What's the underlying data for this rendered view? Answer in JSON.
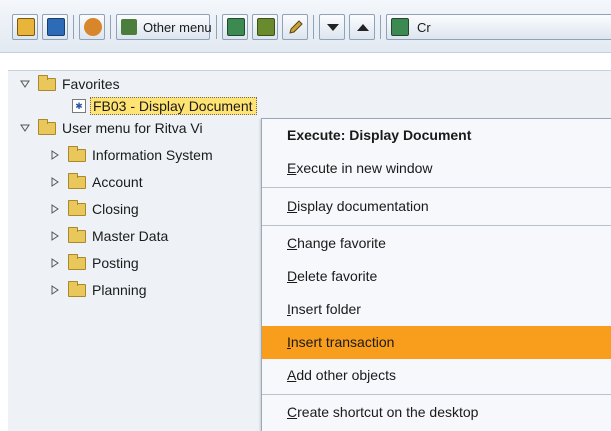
{
  "toolbar": {
    "other_menu_label": "Other menu",
    "create_label_partial": "Cr",
    "buttons": [
      {
        "name": "add-favorite-icon",
        "color": "#e8b43a"
      },
      {
        "name": "favorites-icon",
        "color": "#2e6bb7"
      },
      {
        "name": "refresh-icon",
        "color": "#d8862b"
      },
      {
        "name": "other-menu-icon",
        "color": "#4b7e3c"
      },
      {
        "name": "change-favorite-icon",
        "color": "#3c8a52"
      },
      {
        "name": "delete-favorite-icon",
        "color": "#6a8a2e"
      },
      {
        "name": "pencil-icon",
        "color": "#c9a23a"
      },
      {
        "name": "move-down-icon",
        "color": "#222222"
      },
      {
        "name": "move-up-icon",
        "color": "#222222"
      },
      {
        "name": "create-role-icon",
        "color": "#3c8a52"
      }
    ]
  },
  "tree": {
    "favorites_label": "Favorites",
    "favorite_item": "FB03 - Display Document",
    "user_menu_label": "User menu for Ritva Vi",
    "children": [
      "Information System",
      "Account",
      "Closing",
      "Master Data",
      "Posting",
      "Planning"
    ]
  },
  "context_menu": {
    "execute": "Execute: Display Document",
    "execute_new_window": {
      "first": "E",
      "rest": "xecute in new window"
    },
    "display_documentation": {
      "first": "D",
      "rest": "isplay documentation"
    },
    "change_favorite": {
      "first": "C",
      "rest": "hange favorite"
    },
    "delete_favorite": {
      "first": "D",
      "rest": "elete favorite"
    },
    "insert_folder": {
      "first": "I",
      "rest": "nsert folder"
    },
    "insert_transaction": {
      "first": "I",
      "rest": "nsert transaction"
    },
    "add_other_objects": {
      "first": "A",
      "rest": "dd other objects"
    },
    "create_shortcut": {
      "first": "C",
      "rest": "reate shortcut on the desktop"
    }
  },
  "colors": {
    "highlight": "#f99d1c",
    "selection": "#ffe373",
    "tree_bg": "#eef2f6"
  }
}
